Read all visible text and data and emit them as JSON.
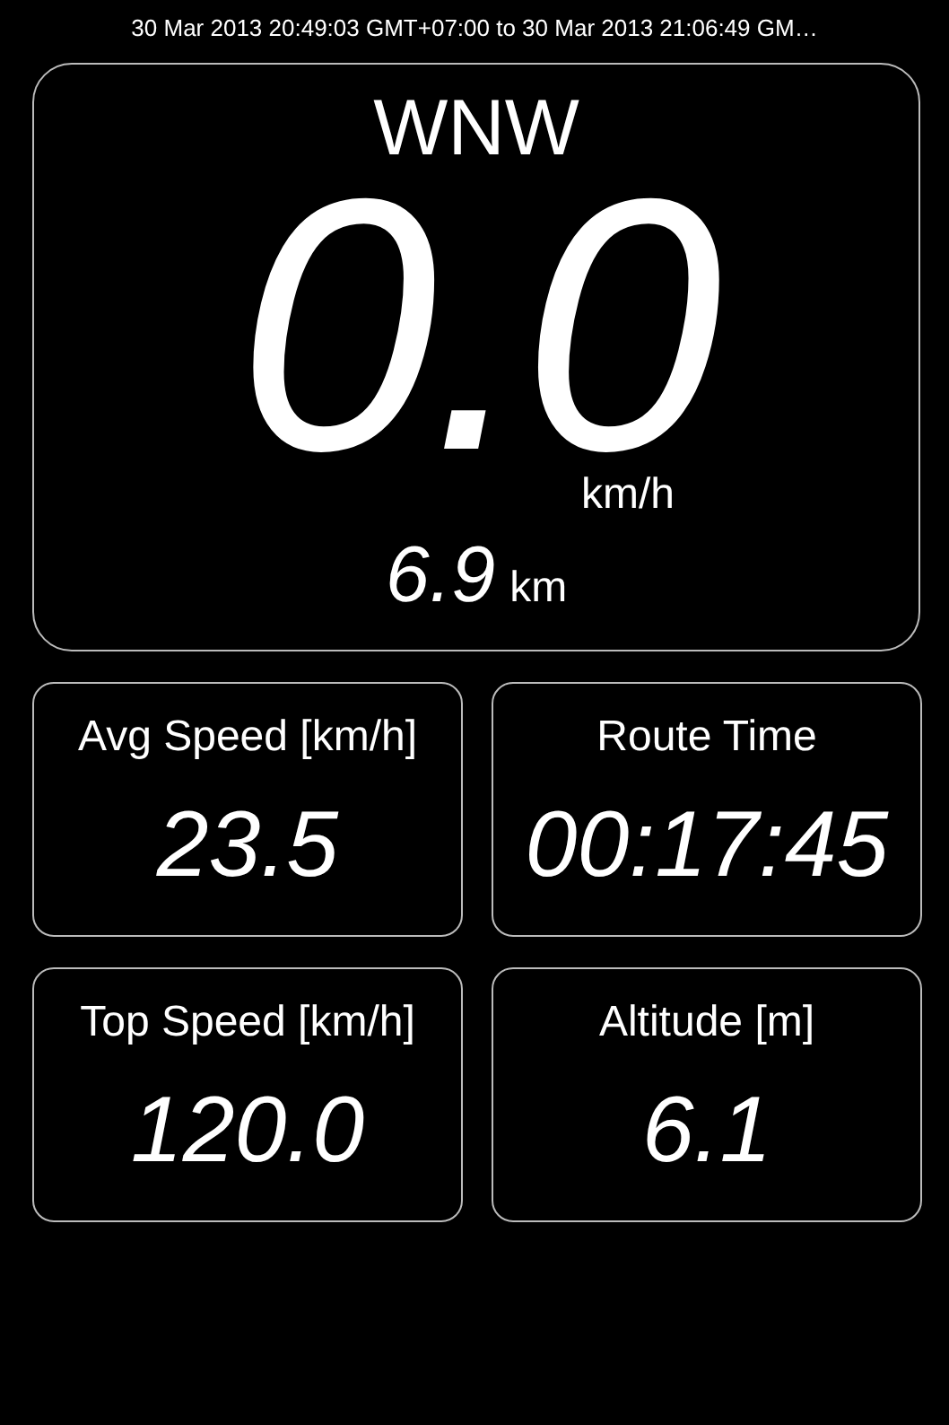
{
  "header": {
    "time_range": "30 Mar 2013 20:49:03 GMT+07:00 to 30 Mar 2013 21:06:49 GM…"
  },
  "main": {
    "heading": "WNW",
    "speed": "0.0",
    "speed_unit": "km/h",
    "distance": "6.9",
    "distance_unit": "km"
  },
  "stats": [
    {
      "label": "Avg Speed [km/h]",
      "value": "23.5"
    },
    {
      "label": "Route Time",
      "value": "00:17:45"
    },
    {
      "label": "Top Speed [km/h]",
      "value": "120.0"
    },
    {
      "label": "Altitude [m]",
      "value": "6.1"
    }
  ]
}
